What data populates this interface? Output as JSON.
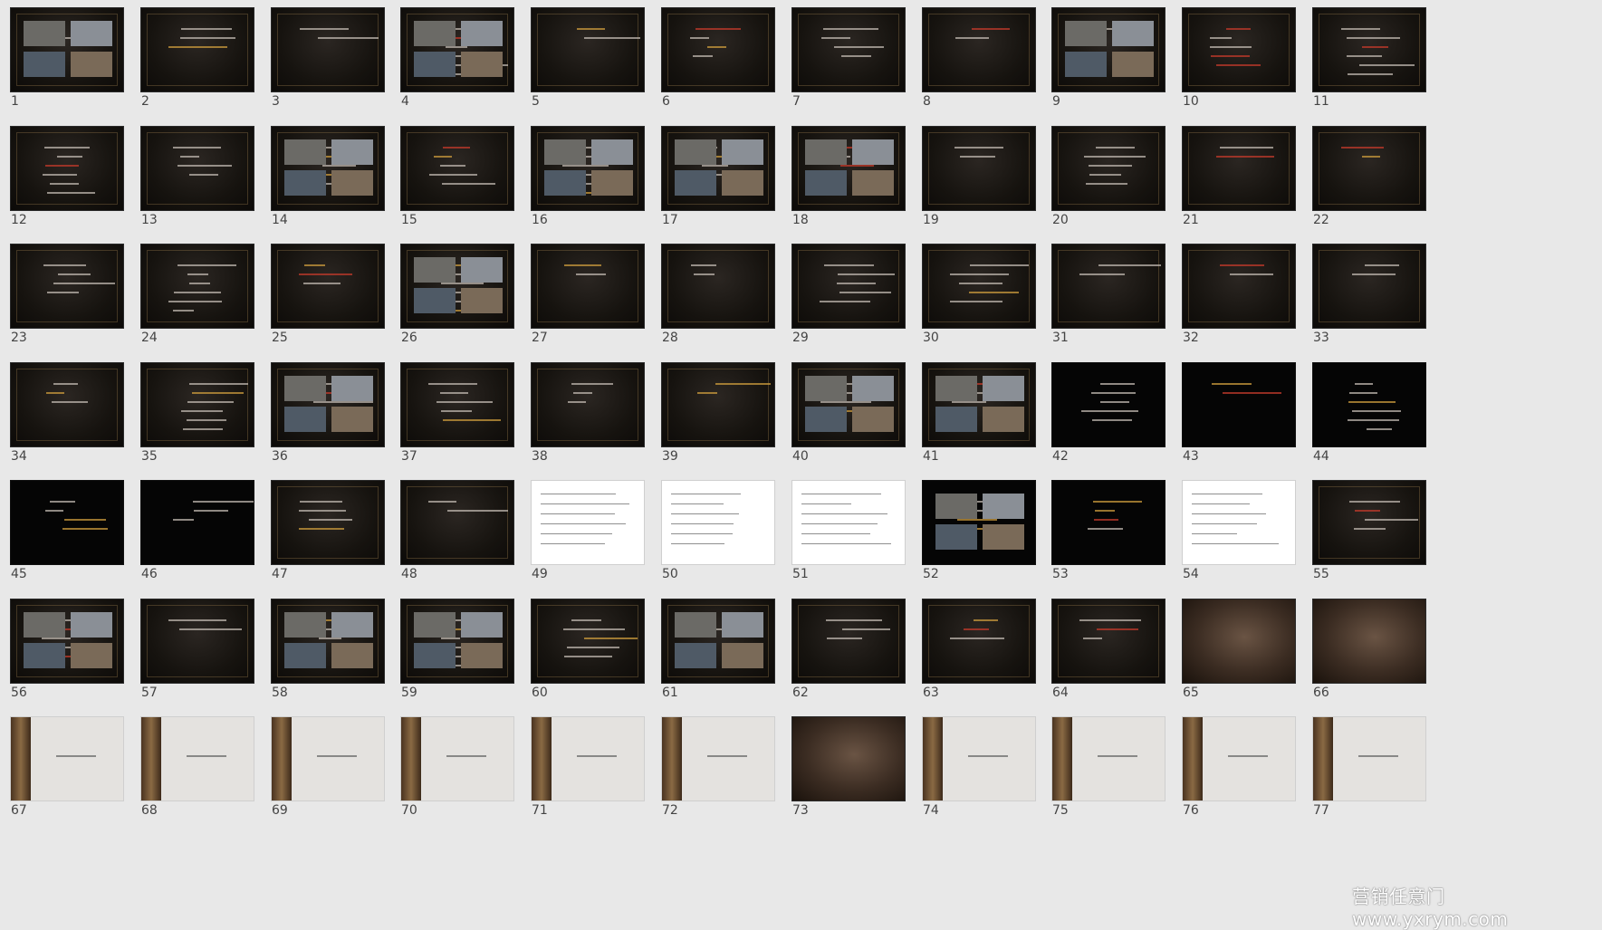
{
  "slides": [
    {
      "n": "1",
      "s": "dark"
    },
    {
      "n": "2",
      "s": "dark"
    },
    {
      "n": "3",
      "s": "dark"
    },
    {
      "n": "4",
      "s": "dark"
    },
    {
      "n": "5",
      "s": "dark"
    },
    {
      "n": "6",
      "s": "dark"
    },
    {
      "n": "7",
      "s": "dark"
    },
    {
      "n": "8",
      "s": "dark"
    },
    {
      "n": "9",
      "s": "dark"
    },
    {
      "n": "10",
      "s": "dark"
    },
    {
      "n": "11",
      "s": "dark"
    },
    {
      "n": "12",
      "s": "dark"
    },
    {
      "n": "13",
      "s": "dark"
    },
    {
      "n": "14",
      "s": "dark"
    },
    {
      "n": "15",
      "s": "dark"
    },
    {
      "n": "16",
      "s": "dark"
    },
    {
      "n": "17",
      "s": "dark"
    },
    {
      "n": "18",
      "s": "dark"
    },
    {
      "n": "19",
      "s": "dark"
    },
    {
      "n": "20",
      "s": "dark"
    },
    {
      "n": "21",
      "s": "dark"
    },
    {
      "n": "22",
      "s": "dark"
    },
    {
      "n": "23",
      "s": "dark"
    },
    {
      "n": "24",
      "s": "dark"
    },
    {
      "n": "25",
      "s": "dark"
    },
    {
      "n": "26",
      "s": "dark"
    },
    {
      "n": "27",
      "s": "dark"
    },
    {
      "n": "28",
      "s": "dark"
    },
    {
      "n": "29",
      "s": "dark"
    },
    {
      "n": "30",
      "s": "dark"
    },
    {
      "n": "31",
      "s": "dark"
    },
    {
      "n": "32",
      "s": "dark"
    },
    {
      "n": "33",
      "s": "dark"
    },
    {
      "n": "34",
      "s": "dark"
    },
    {
      "n": "35",
      "s": "dark"
    },
    {
      "n": "36",
      "s": "dark"
    },
    {
      "n": "37",
      "s": "dark"
    },
    {
      "n": "38",
      "s": "dark"
    },
    {
      "n": "39",
      "s": "dark"
    },
    {
      "n": "40",
      "s": "dark"
    },
    {
      "n": "41",
      "s": "dark"
    },
    {
      "n": "42",
      "s": "black"
    },
    {
      "n": "43",
      "s": "black"
    },
    {
      "n": "44",
      "s": "black"
    },
    {
      "n": "45",
      "s": "black"
    },
    {
      "n": "46",
      "s": "black"
    },
    {
      "n": "47",
      "s": "dark"
    },
    {
      "n": "48",
      "s": "dark"
    },
    {
      "n": "49",
      "s": "white"
    },
    {
      "n": "50",
      "s": "white"
    },
    {
      "n": "51",
      "s": "white"
    },
    {
      "n": "52",
      "s": "black"
    },
    {
      "n": "53",
      "s": "black"
    },
    {
      "n": "54",
      "s": "white"
    },
    {
      "n": "55",
      "s": "dark"
    },
    {
      "n": "56",
      "s": "dark"
    },
    {
      "n": "57",
      "s": "dark"
    },
    {
      "n": "58",
      "s": "dark"
    },
    {
      "n": "59",
      "s": "dark"
    },
    {
      "n": "60",
      "s": "dark"
    },
    {
      "n": "61",
      "s": "dark"
    },
    {
      "n": "62",
      "s": "dark"
    },
    {
      "n": "63",
      "s": "dark"
    },
    {
      "n": "64",
      "s": "dark"
    },
    {
      "n": "65",
      "s": "photo"
    },
    {
      "n": "66",
      "s": "photo"
    },
    {
      "n": "67",
      "s": "gray"
    },
    {
      "n": "68",
      "s": "gray"
    },
    {
      "n": "69",
      "s": "gray"
    },
    {
      "n": "70",
      "s": "gray"
    },
    {
      "n": "71",
      "s": "gray"
    },
    {
      "n": "72",
      "s": "gray"
    },
    {
      "n": "73",
      "s": "photo"
    },
    {
      "n": "74",
      "s": "gray"
    },
    {
      "n": "75",
      "s": "gray"
    },
    {
      "n": "76",
      "s": "gray"
    },
    {
      "n": "77",
      "s": "gray"
    }
  ],
  "watermark": "营销任意门 www.yxrym.com",
  "colors": {
    "background": "#e8e8e8",
    "slide_dark": "#16130f",
    "gold_text": "#c99a3c",
    "red_text": "#c0392b"
  }
}
